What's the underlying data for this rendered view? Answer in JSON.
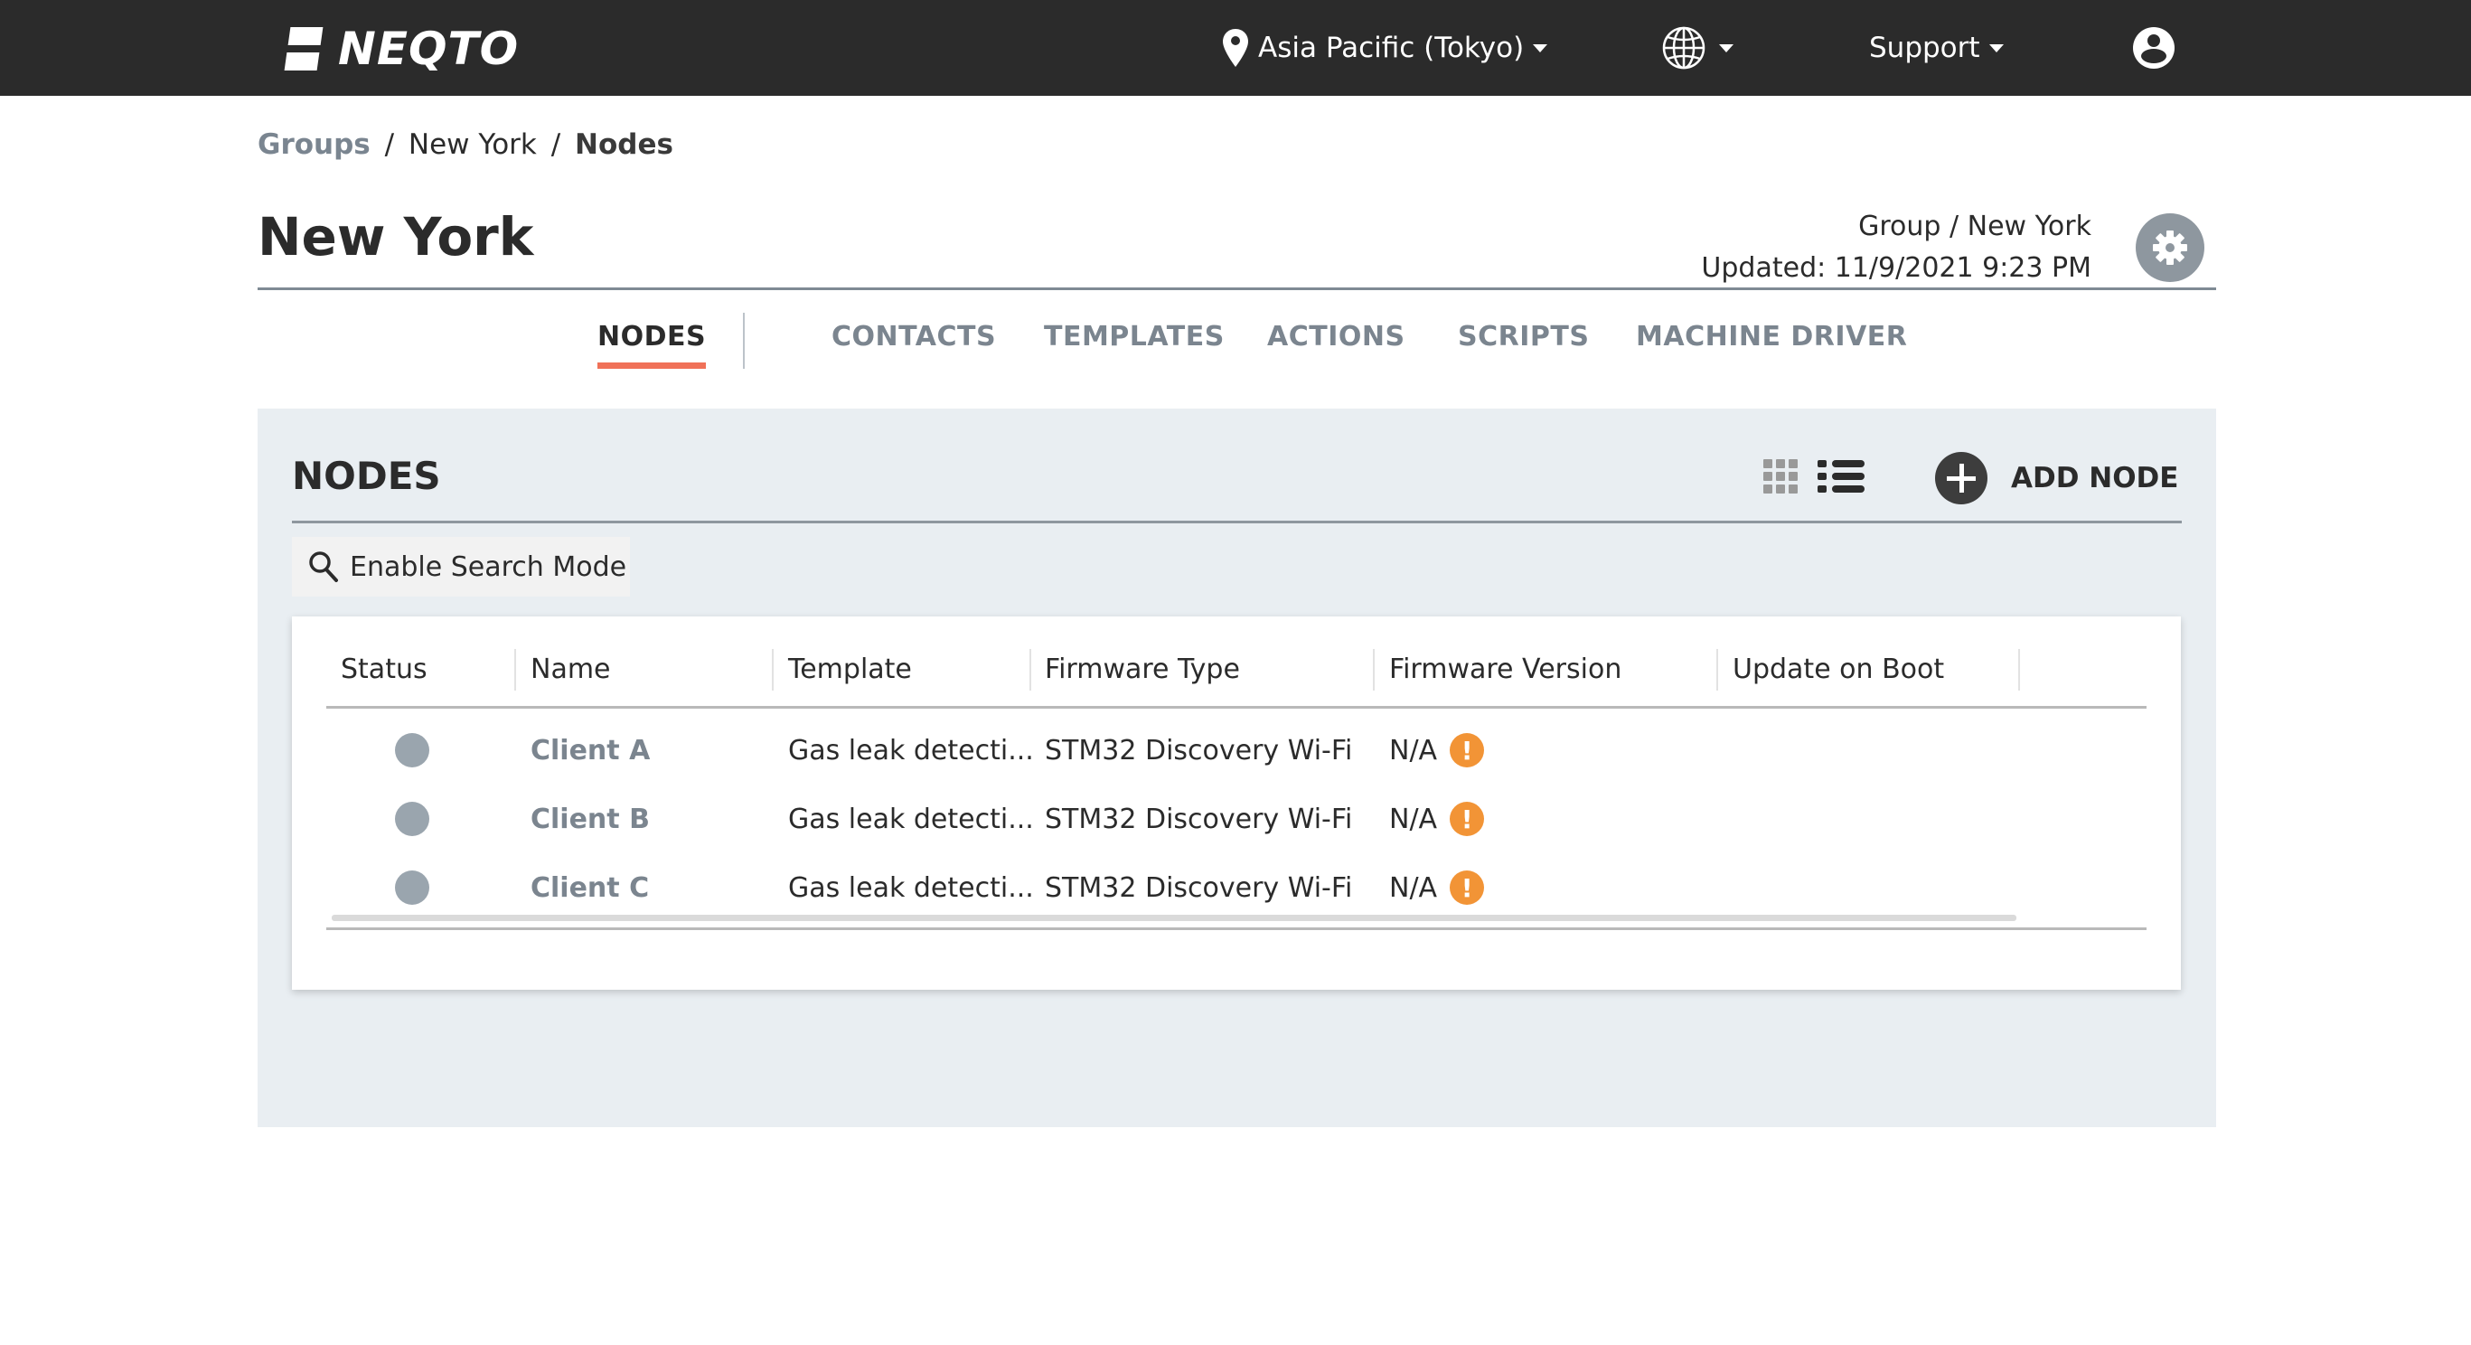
{
  "topbar": {
    "logo_text": "NEQTO",
    "region": {
      "icon": "map-pin-icon",
      "label": "Asia Pacific (Tokyo)"
    },
    "language": {
      "icon": "globe-icon"
    },
    "support": {
      "label": "Support"
    },
    "user": {
      "icon": "user-account-icon"
    }
  },
  "breadcrumb": {
    "items": [
      "Groups",
      "New York",
      "Nodes"
    ],
    "separator": "/"
  },
  "page": {
    "title": "New York",
    "group_path": "Group / New York",
    "updated": "Updated: 11/9/2021 9:23 PM"
  },
  "tabs": [
    {
      "label": "NODES",
      "active": true
    },
    {
      "label": "CONTACTS",
      "active": false
    },
    {
      "label": "TEMPLATES",
      "active": false
    },
    {
      "label": "ACTIONS",
      "active": false
    },
    {
      "label": "SCRIPTS",
      "active": false
    },
    {
      "label": "MACHINE DRIVER",
      "active": false
    }
  ],
  "panel": {
    "title": "NODES",
    "add_label": "ADD NODE",
    "search_label": "Enable Search Mode",
    "view_mode": "list"
  },
  "table": {
    "columns": [
      "Status",
      "Name",
      "Template",
      "Firmware Type",
      "Firmware Version",
      "Update on Boot"
    ],
    "rows": [
      {
        "status": "offline",
        "name": "Client A",
        "template": "Gas leak detecti...",
        "firmware_type": "STM32 Discovery Wi-Fi",
        "firmware_version": "N/A",
        "warning": "!",
        "update_on_boot": ""
      },
      {
        "status": "offline",
        "name": "Client B",
        "template": "Gas leak detecti...",
        "firmware_type": "STM32 Discovery Wi-Fi",
        "firmware_version": "N/A",
        "warning": "!",
        "update_on_boot": ""
      },
      {
        "status": "offline",
        "name": "Client C",
        "template": "Gas leak detecti...",
        "firmware_type": "STM32 Discovery Wi-Fi",
        "firmware_version": "N/A",
        "warning": "!",
        "update_on_boot": ""
      }
    ]
  },
  "colors": {
    "topbar_bg": "#2b2b2b",
    "active_tab_underline": "#f07158",
    "panel_bg": "#e9eef2",
    "warning": "#f29436",
    "status_offline": "#9aa5ae",
    "link_gray": "#7b858f"
  }
}
